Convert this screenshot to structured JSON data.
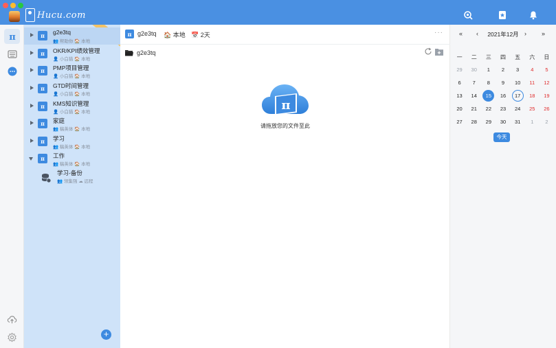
{
  "app": {
    "logo_text": "Hucu.com",
    "colors": {
      "accent": "#4a90e2",
      "brand_blue": "#3d8ae0",
      "sidebar_bg": "#cfe3f9",
      "weekend_red": "#e02b2b"
    }
  },
  "toolbar": {
    "icons": [
      "search-target-icon",
      "bookmark-icon",
      "bell-icon"
    ]
  },
  "rail": {
    "items": [
      "logo-pi-icon",
      "keyboard-icon",
      "chat-bubble-icon"
    ],
    "bottom": [
      "cloud-upload-icon",
      "gear-icon"
    ]
  },
  "sidebar": {
    "ribbon": "",
    "items": [
      {
        "title": "g2e3tq",
        "meta": "👥 帮助你 🏠 本地"
      },
      {
        "title": "OKR/KPI绩效管理",
        "meta": "👤 小白猫 🏠 本地"
      },
      {
        "title": "PMP项目管理",
        "meta": "👤 小白猫 🏠 本地"
      },
      {
        "title": "GTD时间管理",
        "meta": "👤 小白猫 🏠 本地"
      },
      {
        "title": "KMS知识管理",
        "meta": "👤 小白猫 🏠 本地"
      },
      {
        "title": "家庭",
        "meta": "👥 稿英体 🏠 本地"
      },
      {
        "title": "学习",
        "meta": "👥 稿英体 🏠 本地"
      },
      {
        "title": "工作",
        "meta": "👥 稿英体 🏠 本地"
      }
    ],
    "backup": {
      "title": "学习-备份",
      "meta": "👥 领集强 ☁ 远程"
    },
    "add_label": "+"
  },
  "main": {
    "db_icon_text": "π",
    "name": "g2e3tq",
    "location": "🏠 本地",
    "days": "📅 2天",
    "more": "···",
    "path": "g2e3tq",
    "drop_text": "请拖放您的文件至此"
  },
  "calendar": {
    "prev_year": "«",
    "prev_month": "‹",
    "title": "2021年12月",
    "next_month": "›",
    "next_year": "»",
    "weekdays": [
      "一",
      "二",
      "三",
      "四",
      "五",
      "六",
      "日"
    ],
    "weeks": [
      [
        {
          "d": "29",
          "t": "muted"
        },
        {
          "d": "30",
          "t": "muted"
        },
        {
          "d": "1"
        },
        {
          "d": "2"
        },
        {
          "d": "3"
        },
        {
          "d": "4",
          "t": "weekend"
        },
        {
          "d": "5",
          "t": "weekend"
        }
      ],
      [
        {
          "d": "6"
        },
        {
          "d": "7"
        },
        {
          "d": "8"
        },
        {
          "d": "9"
        },
        {
          "d": "10"
        },
        {
          "d": "11",
          "t": "weekend"
        },
        {
          "d": "12",
          "t": "weekend"
        }
      ],
      [
        {
          "d": "13"
        },
        {
          "d": "14"
        },
        {
          "d": "15",
          "t": "selected"
        },
        {
          "d": "16"
        },
        {
          "d": "17",
          "t": "today"
        },
        {
          "d": "18",
          "t": "weekend"
        },
        {
          "d": "19",
          "t": "weekend"
        }
      ],
      [
        {
          "d": "20"
        },
        {
          "d": "21"
        },
        {
          "d": "22"
        },
        {
          "d": "23"
        },
        {
          "d": "24"
        },
        {
          "d": "25",
          "t": "weekend"
        },
        {
          "d": "26",
          "t": "weekend"
        }
      ],
      [
        {
          "d": "27"
        },
        {
          "d": "28"
        },
        {
          "d": "29"
        },
        {
          "d": "30"
        },
        {
          "d": "31"
        },
        {
          "d": "1",
          "t": "muted"
        },
        {
          "d": "2",
          "t": "muted"
        }
      ]
    ],
    "today_label": "今天"
  }
}
